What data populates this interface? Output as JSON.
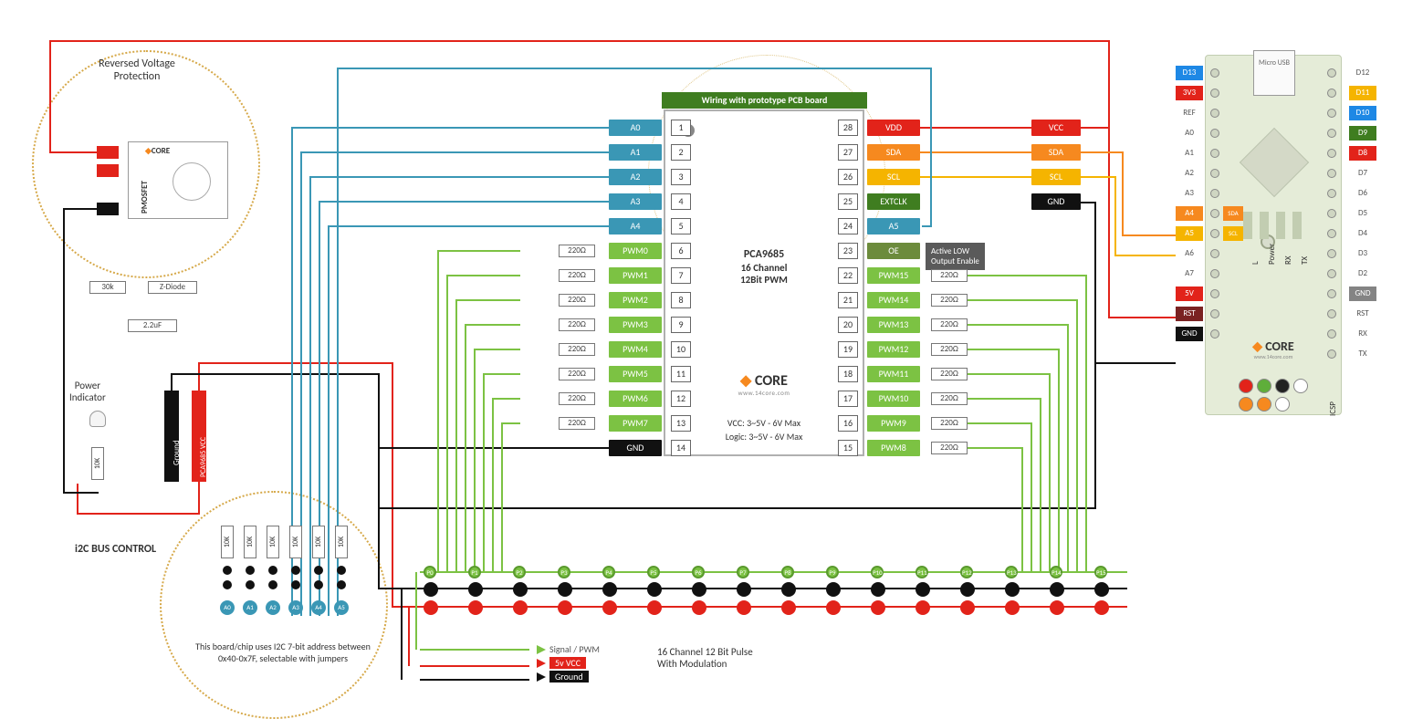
{
  "header": {
    "pcb_title": "Wiring with prototype PCB board"
  },
  "chip": {
    "name": "PCA9685",
    "sub1": "16 Channel",
    "sub2": "12Bit PWM",
    "logo": "CORE",
    "logo_sub": "www.14core.com",
    "vcc": "VCC: 3~5V - 6V Max",
    "logic": "Logic: 3~5V - 6V Max",
    "pins_left": [
      {
        "n": "1",
        "lbl": "A0",
        "cls": "t-teal"
      },
      {
        "n": "2",
        "lbl": "A1",
        "cls": "t-teal"
      },
      {
        "n": "3",
        "lbl": "A2",
        "cls": "t-teal"
      },
      {
        "n": "4",
        "lbl": "A3",
        "cls": "t-teal"
      },
      {
        "n": "5",
        "lbl": "A4",
        "cls": "t-teal"
      },
      {
        "n": "6",
        "lbl": "PWM0",
        "cls": "t-green",
        "res": "220Ω"
      },
      {
        "n": "7",
        "lbl": "PWM1",
        "cls": "t-green",
        "res": "220Ω"
      },
      {
        "n": "8",
        "lbl": "PWM2",
        "cls": "t-green",
        "res": "220Ω"
      },
      {
        "n": "9",
        "lbl": "PWM3",
        "cls": "t-green",
        "res": "220Ω"
      },
      {
        "n": "10",
        "lbl": "PWM4",
        "cls": "t-green",
        "res": "220Ω"
      },
      {
        "n": "11",
        "lbl": "PWM5",
        "cls": "t-green",
        "res": "220Ω"
      },
      {
        "n": "12",
        "lbl": "PWM6",
        "cls": "t-green",
        "res": "220Ω"
      },
      {
        "n": "13",
        "lbl": "PWM7",
        "cls": "t-green",
        "res": "220Ω"
      },
      {
        "n": "14",
        "lbl": "GND",
        "cls": "t-black"
      }
    ],
    "pins_right": [
      {
        "n": "28",
        "lbl": "VDD",
        "cls": "t-red"
      },
      {
        "n": "27",
        "lbl": "SDA",
        "cls": "t-orange"
      },
      {
        "n": "26",
        "lbl": "SCL",
        "cls": "t-yellow"
      },
      {
        "n": "25",
        "lbl": "EXTCLK",
        "cls": "t-dgreen"
      },
      {
        "n": "24",
        "lbl": "A5",
        "cls": "t-teal"
      },
      {
        "n": "23",
        "lbl": "OE",
        "cls": "t-olive"
      },
      {
        "n": "22",
        "lbl": "PWM15",
        "cls": "t-green",
        "res": "220Ω"
      },
      {
        "n": "21",
        "lbl": "PWM14",
        "cls": "t-green",
        "res": "220Ω"
      },
      {
        "n": "20",
        "lbl": "PWM13",
        "cls": "t-green",
        "res": "220Ω"
      },
      {
        "n": "19",
        "lbl": "PWM12",
        "cls": "t-green",
        "res": "220Ω"
      },
      {
        "n": "18",
        "lbl": "PWM11",
        "cls": "t-green",
        "res": "220Ω"
      },
      {
        "n": "17",
        "lbl": "PWM10",
        "cls": "t-green",
        "res": "220Ω"
      },
      {
        "n": "16",
        "lbl": "PWM9",
        "cls": "t-green",
        "res": "220Ω"
      },
      {
        "n": "15",
        "lbl": "PWM8",
        "cls": "t-green",
        "res": "220Ω"
      }
    ]
  },
  "side_pins": {
    "vcc": "VCC",
    "sda": "SDA",
    "scl": "SCL",
    "gnd": "GND"
  },
  "oe_note": {
    "l1": "Active LOW",
    "l2": "Output Enable"
  },
  "protection": {
    "title1": "Reversed Voltage",
    "title2": "Protection",
    "pmosfet": "PMOSFET",
    "r30k": "30k",
    "zdiode": "Z-Diode",
    "cap": "2.2uF",
    "power_ind": "Power\nIndicator",
    "r10k": "10K",
    "gnd_post": "Ground",
    "vcc_post": "PCA9685 VCC",
    "logo": "CORE"
  },
  "i2c": {
    "title": "i2C BUS CONTROL",
    "note1": "This board/chip uses I2C 7-bit address between",
    "note2": "0x40-0x7F, selectable with jumpers",
    "resistors": [
      "10K",
      "10K",
      "10K",
      "10K",
      "10K",
      "10K"
    ],
    "addr": [
      "A0",
      "A1",
      "A2",
      "A3",
      "A4",
      "A5"
    ]
  },
  "bus": {
    "ports": [
      "P0",
      "P1",
      "P2",
      "P3",
      "P4",
      "P5",
      "P6",
      "P7",
      "P8",
      "P9",
      "P10",
      "P11",
      "P12",
      "P13",
      "P14",
      "P15"
    ],
    "legend": {
      "signal": "Signal / PWM",
      "vcc": "5v VCC",
      "gnd": "Ground",
      "title1": "16 Channel 12 Bit Pulse",
      "title2": "With Modulation"
    }
  },
  "arduino": {
    "usb": "Micro\nUSB",
    "logo": "CORE",
    "logo_sub": "www.14core.com",
    "left": [
      {
        "lbl": "D13",
        "cls": "t-blue"
      },
      {
        "lbl": "3V3",
        "cls": "t-red"
      },
      {
        "lbl": "REF",
        "cls": ""
      },
      {
        "lbl": "A0",
        "cls": ""
      },
      {
        "lbl": "A1",
        "cls": ""
      },
      {
        "lbl": "A2",
        "cls": ""
      },
      {
        "lbl": "A3",
        "cls": ""
      },
      {
        "lbl": "A4",
        "cls": "t-orange"
      },
      {
        "lbl": "A5",
        "cls": "t-yellow"
      },
      {
        "lbl": "A6",
        "cls": ""
      },
      {
        "lbl": "A7",
        "cls": ""
      },
      {
        "lbl": "5V",
        "cls": "t-red"
      },
      {
        "lbl": "RST",
        "cls": "t-maroon"
      },
      {
        "lbl": "GND",
        "cls": "t-black"
      }
    ],
    "right": [
      {
        "lbl": "D12",
        "cls": ""
      },
      {
        "lbl": "D11",
        "cls": "t-yellow"
      },
      {
        "lbl": "D10",
        "cls": "t-blue"
      },
      {
        "lbl": "D9",
        "cls": "t-dgreen"
      },
      {
        "lbl": "D8",
        "cls": "t-red"
      },
      {
        "lbl": "D7",
        "cls": ""
      },
      {
        "lbl": "D6",
        "cls": ""
      },
      {
        "lbl": "D5",
        "cls": ""
      },
      {
        "lbl": "D4",
        "cls": ""
      },
      {
        "lbl": "D3",
        "cls": ""
      },
      {
        "lbl": "D2",
        "cls": ""
      },
      {
        "lbl": "GND",
        "cls": "t-grey"
      },
      {
        "lbl": "RST",
        "cls": ""
      },
      {
        "lbl": "RX",
        "cls": ""
      },
      {
        "lbl": "TX",
        "cls": ""
      }
    ],
    "icsp": "ICSP",
    "side_labels": [
      "L",
      "Power",
      "RX",
      "TX"
    ],
    "a4_tag": "SDA",
    "a5_tag": "SCL"
  }
}
